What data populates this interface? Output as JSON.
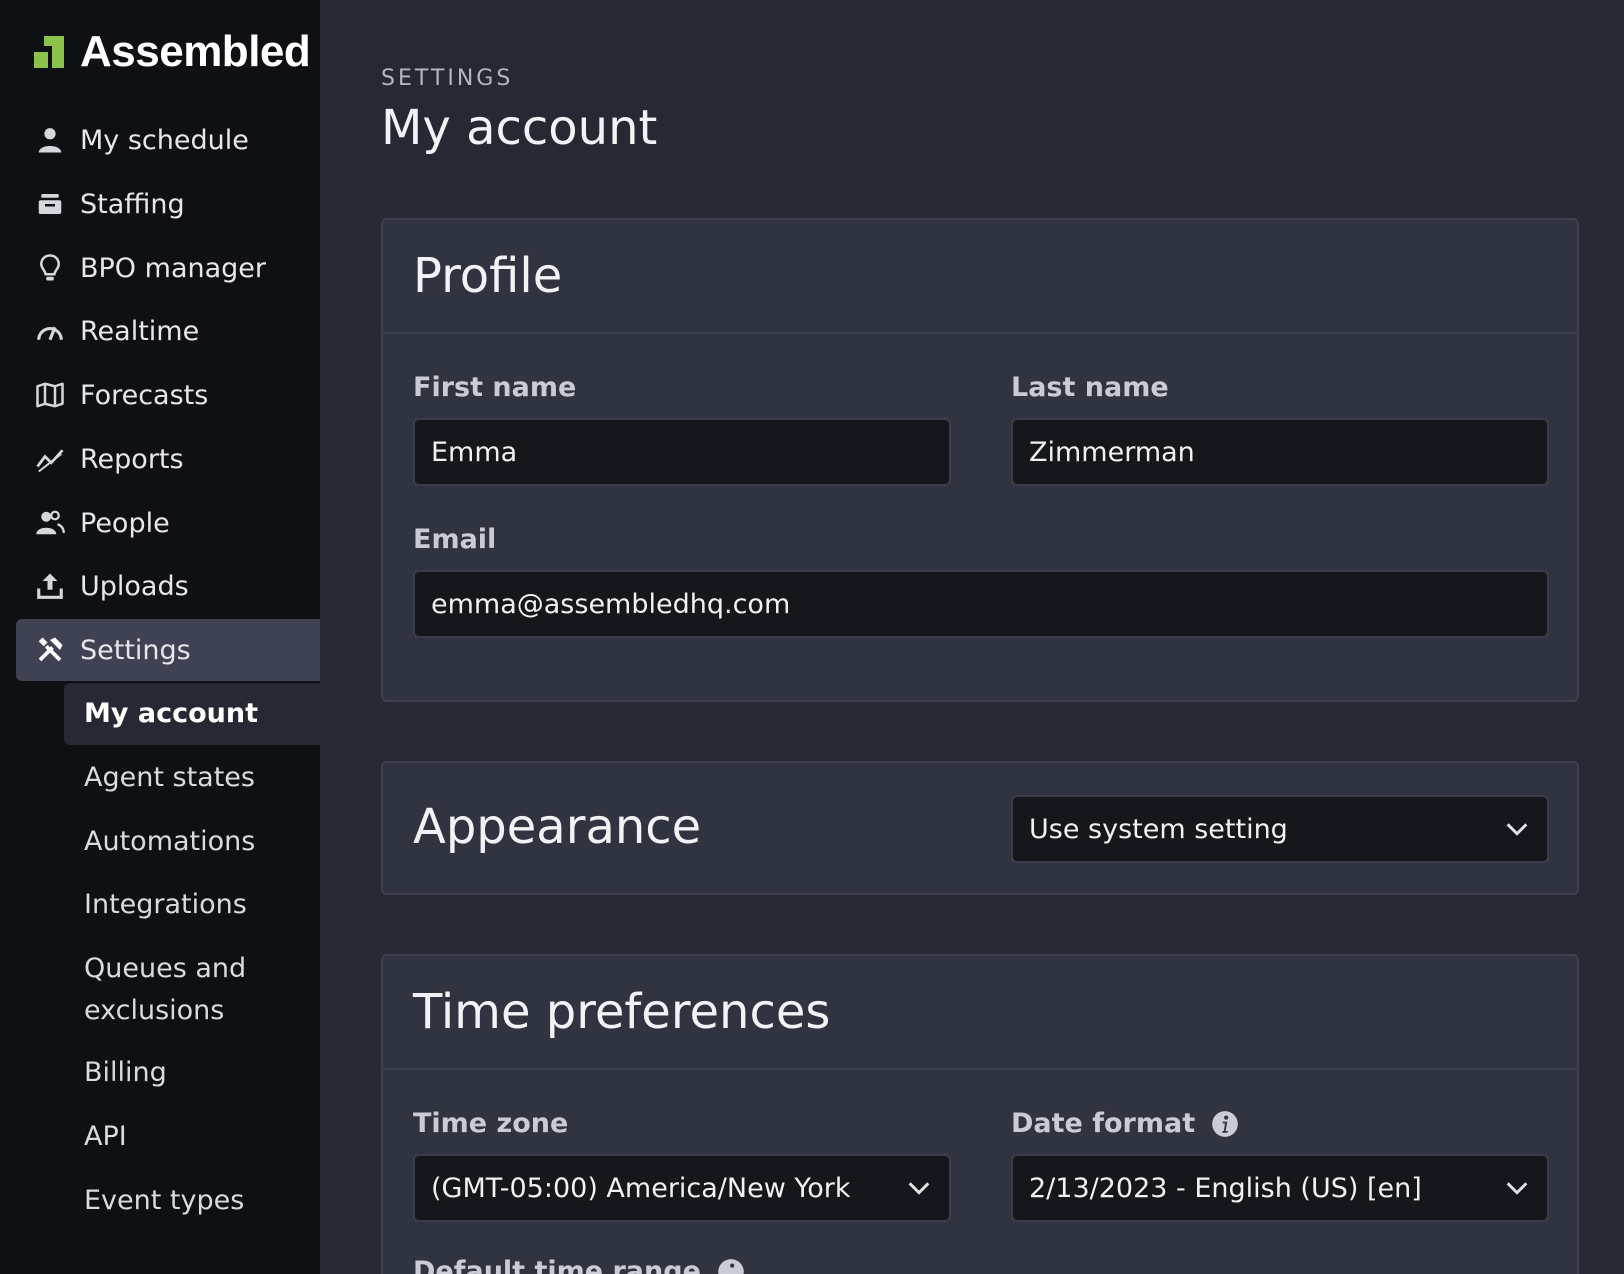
{
  "brand": {
    "name": "Assembled",
    "accent": "#8bc34a"
  },
  "sidebar": {
    "items": [
      {
        "label": "My schedule",
        "icon": "user-icon"
      },
      {
        "label": "Staffing",
        "icon": "inbox-tray-icon"
      },
      {
        "label": "BPO manager",
        "icon": "lightbulb-icon"
      },
      {
        "label": "Realtime",
        "icon": "gauge-icon"
      },
      {
        "label": "Forecasts",
        "icon": "map-icon"
      },
      {
        "label": "Reports",
        "icon": "trend-line-icon"
      },
      {
        "label": "People",
        "icon": "users-icon"
      },
      {
        "label": "Uploads",
        "icon": "upload-icon"
      },
      {
        "label": "Settings",
        "icon": "tools-icon",
        "active": true
      }
    ],
    "sub_items": [
      {
        "label": "My account",
        "active": true
      },
      {
        "label": "Agent states"
      },
      {
        "label": "Automations"
      },
      {
        "label": "Integrations"
      },
      {
        "label": "Queues and exclusions"
      },
      {
        "label": "Billing"
      },
      {
        "label": "API"
      },
      {
        "label": "Event types"
      }
    ]
  },
  "header": {
    "eyebrow": "SETTINGS",
    "title": "My account"
  },
  "profile": {
    "title": "Profile",
    "first_name": {
      "label": "First name",
      "value": "Emma"
    },
    "last_name": {
      "label": "Last name",
      "value": "Zimmerman"
    },
    "email": {
      "label": "Email",
      "value": "emma@assembledhq.com"
    }
  },
  "appearance": {
    "title": "Appearance",
    "selected": "Use system setting"
  },
  "time_preferences": {
    "title": "Time preferences",
    "time_zone": {
      "label": "Time zone",
      "selected": "(GMT-05:00) America/New York"
    },
    "date_format": {
      "label": "Date format",
      "selected": "2/13/2023 - English (US) [en]"
    },
    "default_time_range": {
      "label": "Default time range"
    }
  }
}
